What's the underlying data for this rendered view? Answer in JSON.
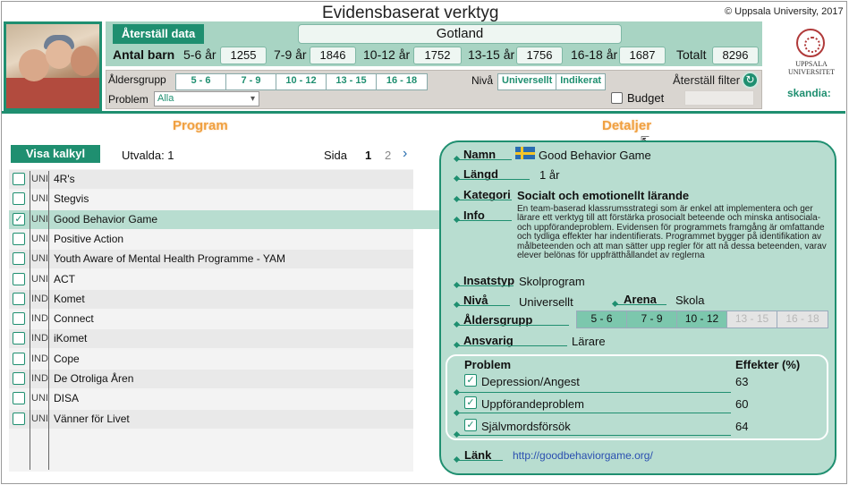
{
  "header": {
    "title": "Evidensbaserat verktyg",
    "copyright": "© Uppsala University, 2017"
  },
  "top": {
    "reset_data": "Återställ data",
    "region": "Gotland",
    "children_label": "Antal barn",
    "groups": [
      {
        "label": "5-6 år",
        "value": "1255"
      },
      {
        "label": "7-9 år",
        "value": "1846"
      },
      {
        "label": "10-12 år",
        "value": "1752"
      },
      {
        "label": "13-15 år",
        "value": "1756"
      },
      {
        "label": "16-18 år",
        "value": "1687"
      },
      {
        "label": "Totalt",
        "value": "8296"
      }
    ]
  },
  "filters": {
    "age_label": "Åldersgrupp",
    "ages": [
      "5 - 6",
      "7 - 9",
      "10 - 12",
      "13 - 15",
      "16 - 18"
    ],
    "level_label": "Nivå",
    "levels": [
      "Universellt",
      "Indikerat"
    ],
    "reset_filter": "Återställ filter",
    "problem_label": "Problem",
    "problem_value": "Alla",
    "budget_label": "Budget"
  },
  "logos": {
    "uu_line1": "UPPSALA",
    "uu_line2": "UNIVERSITET",
    "skandia": "skandia:"
  },
  "sections": {
    "program": "Program",
    "details": "Detaljer"
  },
  "list": {
    "visa_kalkyl": "Visa kalkyl",
    "selected": "Utvalda: 1",
    "page_label": "Sida",
    "page_current": "1",
    "page_other": "2",
    "next_icon": "chevron-right-icon",
    "rows": [
      {
        "type": "UNI",
        "name": "4R's",
        "checked": false
      },
      {
        "type": "UNI",
        "name": "Stegvis",
        "checked": false
      },
      {
        "type": "UNI",
        "name": "Good Behavior Game",
        "checked": true
      },
      {
        "type": "UNI",
        "name": "Positive Action",
        "checked": false
      },
      {
        "type": "UNI",
        "name": "Youth Aware of Mental Health Programme - YAM",
        "checked": false
      },
      {
        "type": "UNI",
        "name": "ACT",
        "checked": false
      },
      {
        "type": "IND",
        "name": "Komet",
        "checked": false
      },
      {
        "type": "IND",
        "name": "Connect",
        "checked": false
      },
      {
        "type": "IND",
        "name": "iKomet",
        "checked": false
      },
      {
        "type": "IND",
        "name": "Cope",
        "checked": false
      },
      {
        "type": "IND",
        "name": "De Otroliga Åren",
        "checked": false
      },
      {
        "type": "UNI",
        "name": "DISA",
        "checked": false
      },
      {
        "type": "UNI",
        "name": "Vänner för Livet",
        "checked": false
      }
    ]
  },
  "details": {
    "name_label": "Namn",
    "name": "Good Behavior Game",
    "length_label": "Längd",
    "length": "1 år",
    "category_label": "Kategori",
    "category": "Socialt och emotionellt lärande",
    "info_label": "Info",
    "info": "En team-baserad klassrumsstrategi som är enkel att implementera och ger lärare ett verktyg till att förstärka prosocialt beteende och minska antisociala- och uppförandeproblem. Evidensen för programmets framgång är omfattande och tydliga effekter har indentifierats. Programmet bygger på identifikation av målbeteenden och att man sätter upp regler för att nå dessa beteenden, varav elever belönas för uppfrätthållandet av reglerna",
    "insats_label": "Insatstyp",
    "insats": "Skolprogram",
    "level_label": "Nivå",
    "level": "Universellt",
    "arena_label": "Arena",
    "arena": "Skola",
    "age_label": "Åldersgrupp",
    "ages": [
      {
        "label": "5 - 6",
        "active": true
      },
      {
        "label": "7 - 9",
        "active": true
      },
      {
        "label": "10 - 12",
        "active": true
      },
      {
        "label": "13 - 15",
        "active": false
      },
      {
        "label": "16 - 18",
        "active": false
      }
    ],
    "responsible_label": "Ansvarig",
    "responsible": "Lärare",
    "problems_header": "Problem",
    "effects_header": "Effekter (%)",
    "problems": [
      {
        "name": "Depression/Angest",
        "value": "63"
      },
      {
        "name": "Uppförandeproblem",
        "value": "60"
      },
      {
        "name": "Självmordsförsök",
        "value": "64"
      }
    ],
    "link_label": "Länk",
    "link": "http://goodbehaviorgame.org/"
  }
}
